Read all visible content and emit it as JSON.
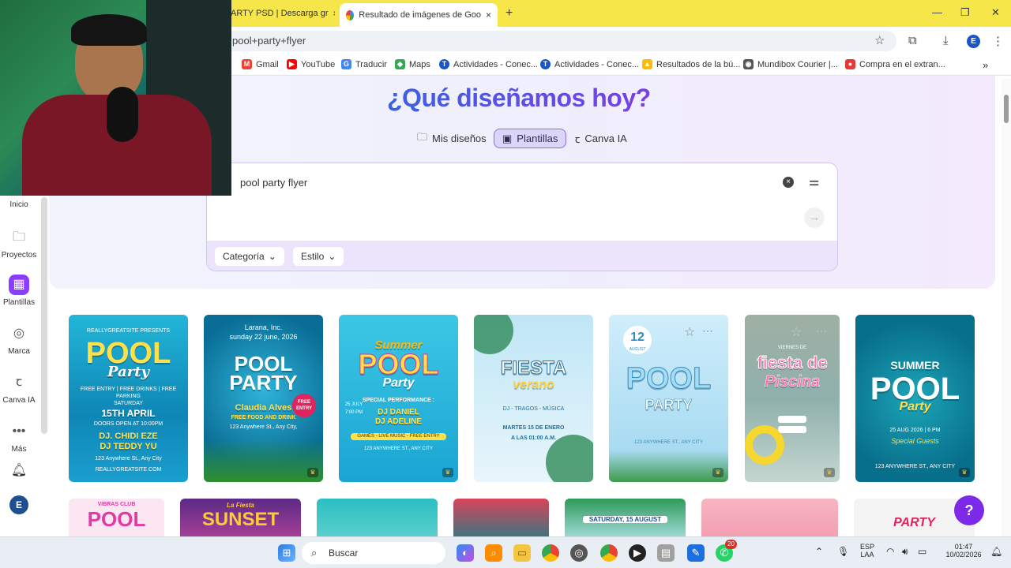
{
  "browser": {
    "tabs": [
      {
        "title": "ARTY PSD | Descarga gr",
        "close": "×"
      },
      {
        "title": "Resultado de imágenes de Goo",
        "close": "×"
      }
    ],
    "new_tab": "+",
    "window": {
      "minimize": "—",
      "maximize": "❐",
      "close": "✕"
    },
    "address": "pool+party+flyer",
    "profile_initial": "E",
    "bookmarks": [
      {
        "label": "Gmail",
        "color": "#ea4335"
      },
      {
        "label": "YouTube",
        "color": "#ff0000"
      },
      {
        "label": "Traducir",
        "color": "#4285f4"
      },
      {
        "label": "Maps",
        "color": "#34a853"
      },
      {
        "label": "Actividades - Conec...",
        "color": "#1a56c8"
      },
      {
        "label": "Actividades - Conec...",
        "color": "#1a56c8"
      },
      {
        "label": "Resultados de la bú...",
        "color": "#fbbc04"
      },
      {
        "label": "Mundibox Courier |...",
        "color": "#555555"
      },
      {
        "label": "Compra en el extran...",
        "color": "#e53935"
      }
    ],
    "more_bookmarks": "»"
  },
  "sidebar": {
    "items": [
      {
        "label": "Inicio",
        "icon": "home-icon"
      },
      {
        "label": "Proyectos",
        "icon": "folder-icon"
      },
      {
        "label": "Plantillas",
        "icon": "templates-icon"
      },
      {
        "label": "Marca",
        "icon": "brand-icon"
      },
      {
        "label": "Canva IA",
        "icon": "canva-ai-icon"
      },
      {
        "label": "Más",
        "icon": "more-icon"
      }
    ],
    "avatar": "E"
  },
  "hero": {
    "title": "¿Qué diseñamos hoy?",
    "tabs": [
      {
        "label": "Mis diseños",
        "active": false
      },
      {
        "label": "Plantillas",
        "active": true
      },
      {
        "label": "Canva IA",
        "active": false
      }
    ]
  },
  "search": {
    "value": "pool party flyer",
    "filters": [
      "Categoría",
      "Estilo"
    ]
  },
  "templates": [
    {
      "title": "POOL",
      "subtitle": "Party",
      "lines": [
        "REALLYGREATSITE PRESENTS",
        "FREE ENTRY | FREE DRINKS | FREE PARKING",
        "SATURDAY",
        "15TH APRIL",
        "DOORS OPEN AT 10:00PM",
        "DJ. CHIDI EZE",
        "DJ TEDDY YU",
        "123 Anywhere St., Any City",
        "REALLYGREATSITE.COM"
      ]
    },
    {
      "title": "POOL PARTY",
      "subtitle": "Larana, Inc.",
      "lines": [
        "sunday 22 june, 2026",
        "Claudia Alves",
        "FREE FOOD AND DRINK",
        "123 Anywhere St., Any City,",
        "FREE ENTRY"
      ]
    },
    {
      "title": "POOL",
      "subtitle": "Summer",
      "lines": [
        "Party",
        "SPECIAL PERFORMANCE :",
        "DJ DANIEL",
        "DJ ADELINE",
        "GAMES - LIVE MUSIC - FREE ENTRY",
        "25 JULY",
        "7:00 PM",
        "123 ANYWHERE ST., ANY CITY"
      ]
    },
    {
      "title": "FIESTA",
      "subtitle": "verano",
      "lines": [
        "DJ - TRAGOS - MÚSICA",
        "MARTES 15 DE ENERO",
        "A LAS 01:00 A.M."
      ]
    },
    {
      "title": "POOL",
      "subtitle": "PARTY",
      "lines": [
        "12",
        "AUGUST",
        "123 ANYWHERE ST., ANY CITY"
      ]
    },
    {
      "title": "fiesta de",
      "subtitle": "Piscina",
      "lines": [
        "VIERNES DE"
      ]
    },
    {
      "title": "POOL",
      "subtitle": "SUMMER",
      "lines": [
        "Party",
        "25 AUG 2026 | 6 PM",
        "Special Guests",
        "123 ANYWHERE ST., ANY CITY"
      ]
    }
  ],
  "templates_row2": [
    {
      "text": "POOL",
      "small": "VIBRAS CLUB"
    },
    {
      "text": "SUNSET",
      "small": "La Fiesta"
    },
    {
      "text": "",
      "small": ""
    },
    {
      "text": "",
      "small": ""
    },
    {
      "text": "",
      "small": "SATURDAY, 15 AUGUST"
    },
    {
      "text": "",
      "small": ""
    },
    {
      "text": "PARTY",
      "small": ""
    }
  ],
  "help": "?",
  "taskbar": {
    "search_placeholder": "Buscar",
    "lang": "ESP",
    "lang2": "LAA",
    "time": "01:47",
    "date": "10/02/2026",
    "whatsapp_badge": "20"
  },
  "colors": {
    "accent": "#7d2ae8",
    "tabbar": "#f7e64a",
    "hero_title_start": "#3c61e0",
    "hero_title_end": "#7a3fe4"
  }
}
